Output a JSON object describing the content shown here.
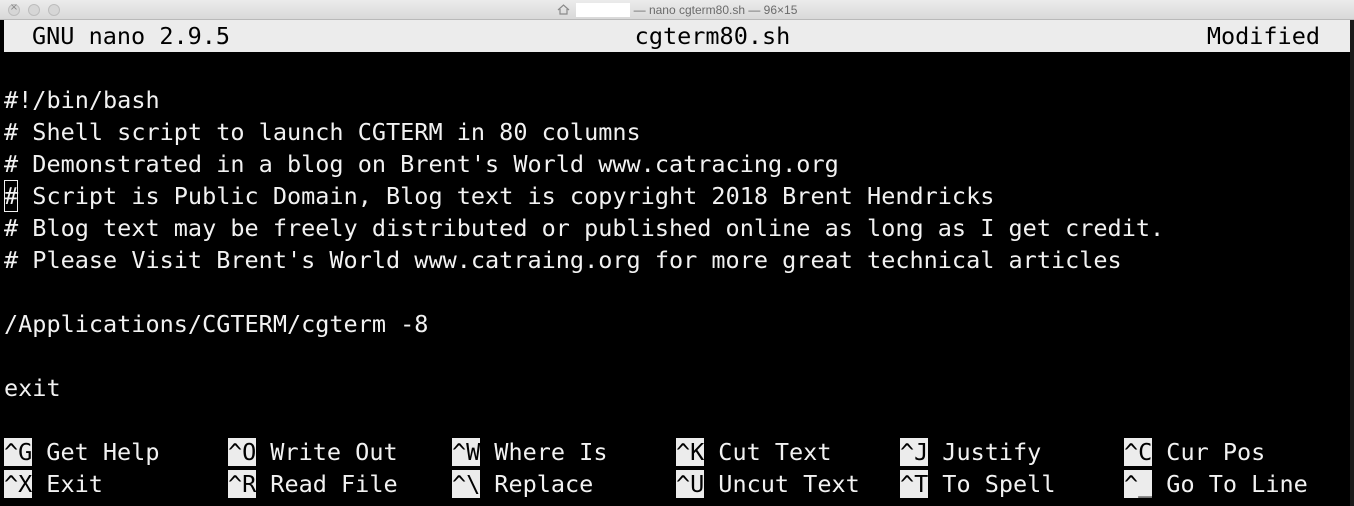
{
  "window": {
    "title_suffix": "— nano cgterm80.sh — 96×15"
  },
  "status": {
    "app": "GNU nano 2.9.5",
    "filename": "cgterm80.sh",
    "state": "Modified"
  },
  "lines": {
    "l1": "#!/bin/bash",
    "l2": "# Shell script to launch CGTERM in 80 columns",
    "l3": "# Demonstrated in a blog on Brent's World www.catracing.org",
    "l4_cursor": "#",
    "l4_rest": " Script is Public Domain, Blog text is copyright 2018 Brent Hendricks",
    "l5": "# Blog text may be freely distributed or published online as long as I get credit.",
    "l6": "# Please Visit Brent's World www.catraing.org for more great technical articles",
    "l7": "/Applications/CGTERM/cgterm -8",
    "l8": "exit"
  },
  "shortcuts": {
    "get_help": {
      "key": "^G",
      "label": "Get Help"
    },
    "write_out": {
      "key": "^O",
      "label": "Write Out"
    },
    "where_is": {
      "key": "^W",
      "label": "Where Is"
    },
    "cut_text": {
      "key": "^K",
      "label": "Cut Text"
    },
    "justify": {
      "key": "^J",
      "label": "Justify"
    },
    "cur_pos": {
      "key": "^C",
      "label": "Cur Pos"
    },
    "exit": {
      "key": "^X",
      "label": "Exit"
    },
    "read_file": {
      "key": "^R",
      "label": "Read File"
    },
    "replace": {
      "key": "^\\",
      "label": "Replace"
    },
    "uncut_text": {
      "key": "^U",
      "label": "Uncut Text"
    },
    "to_spell": {
      "key": "^T",
      "label": "To Spell"
    },
    "go_to_line": {
      "key": "^_",
      "label": "Go To Line"
    }
  },
  "colors": {
    "terminal_bg": "#000000",
    "terminal_fg": "#f2f2f2",
    "inverse_bg": "#ececec"
  }
}
